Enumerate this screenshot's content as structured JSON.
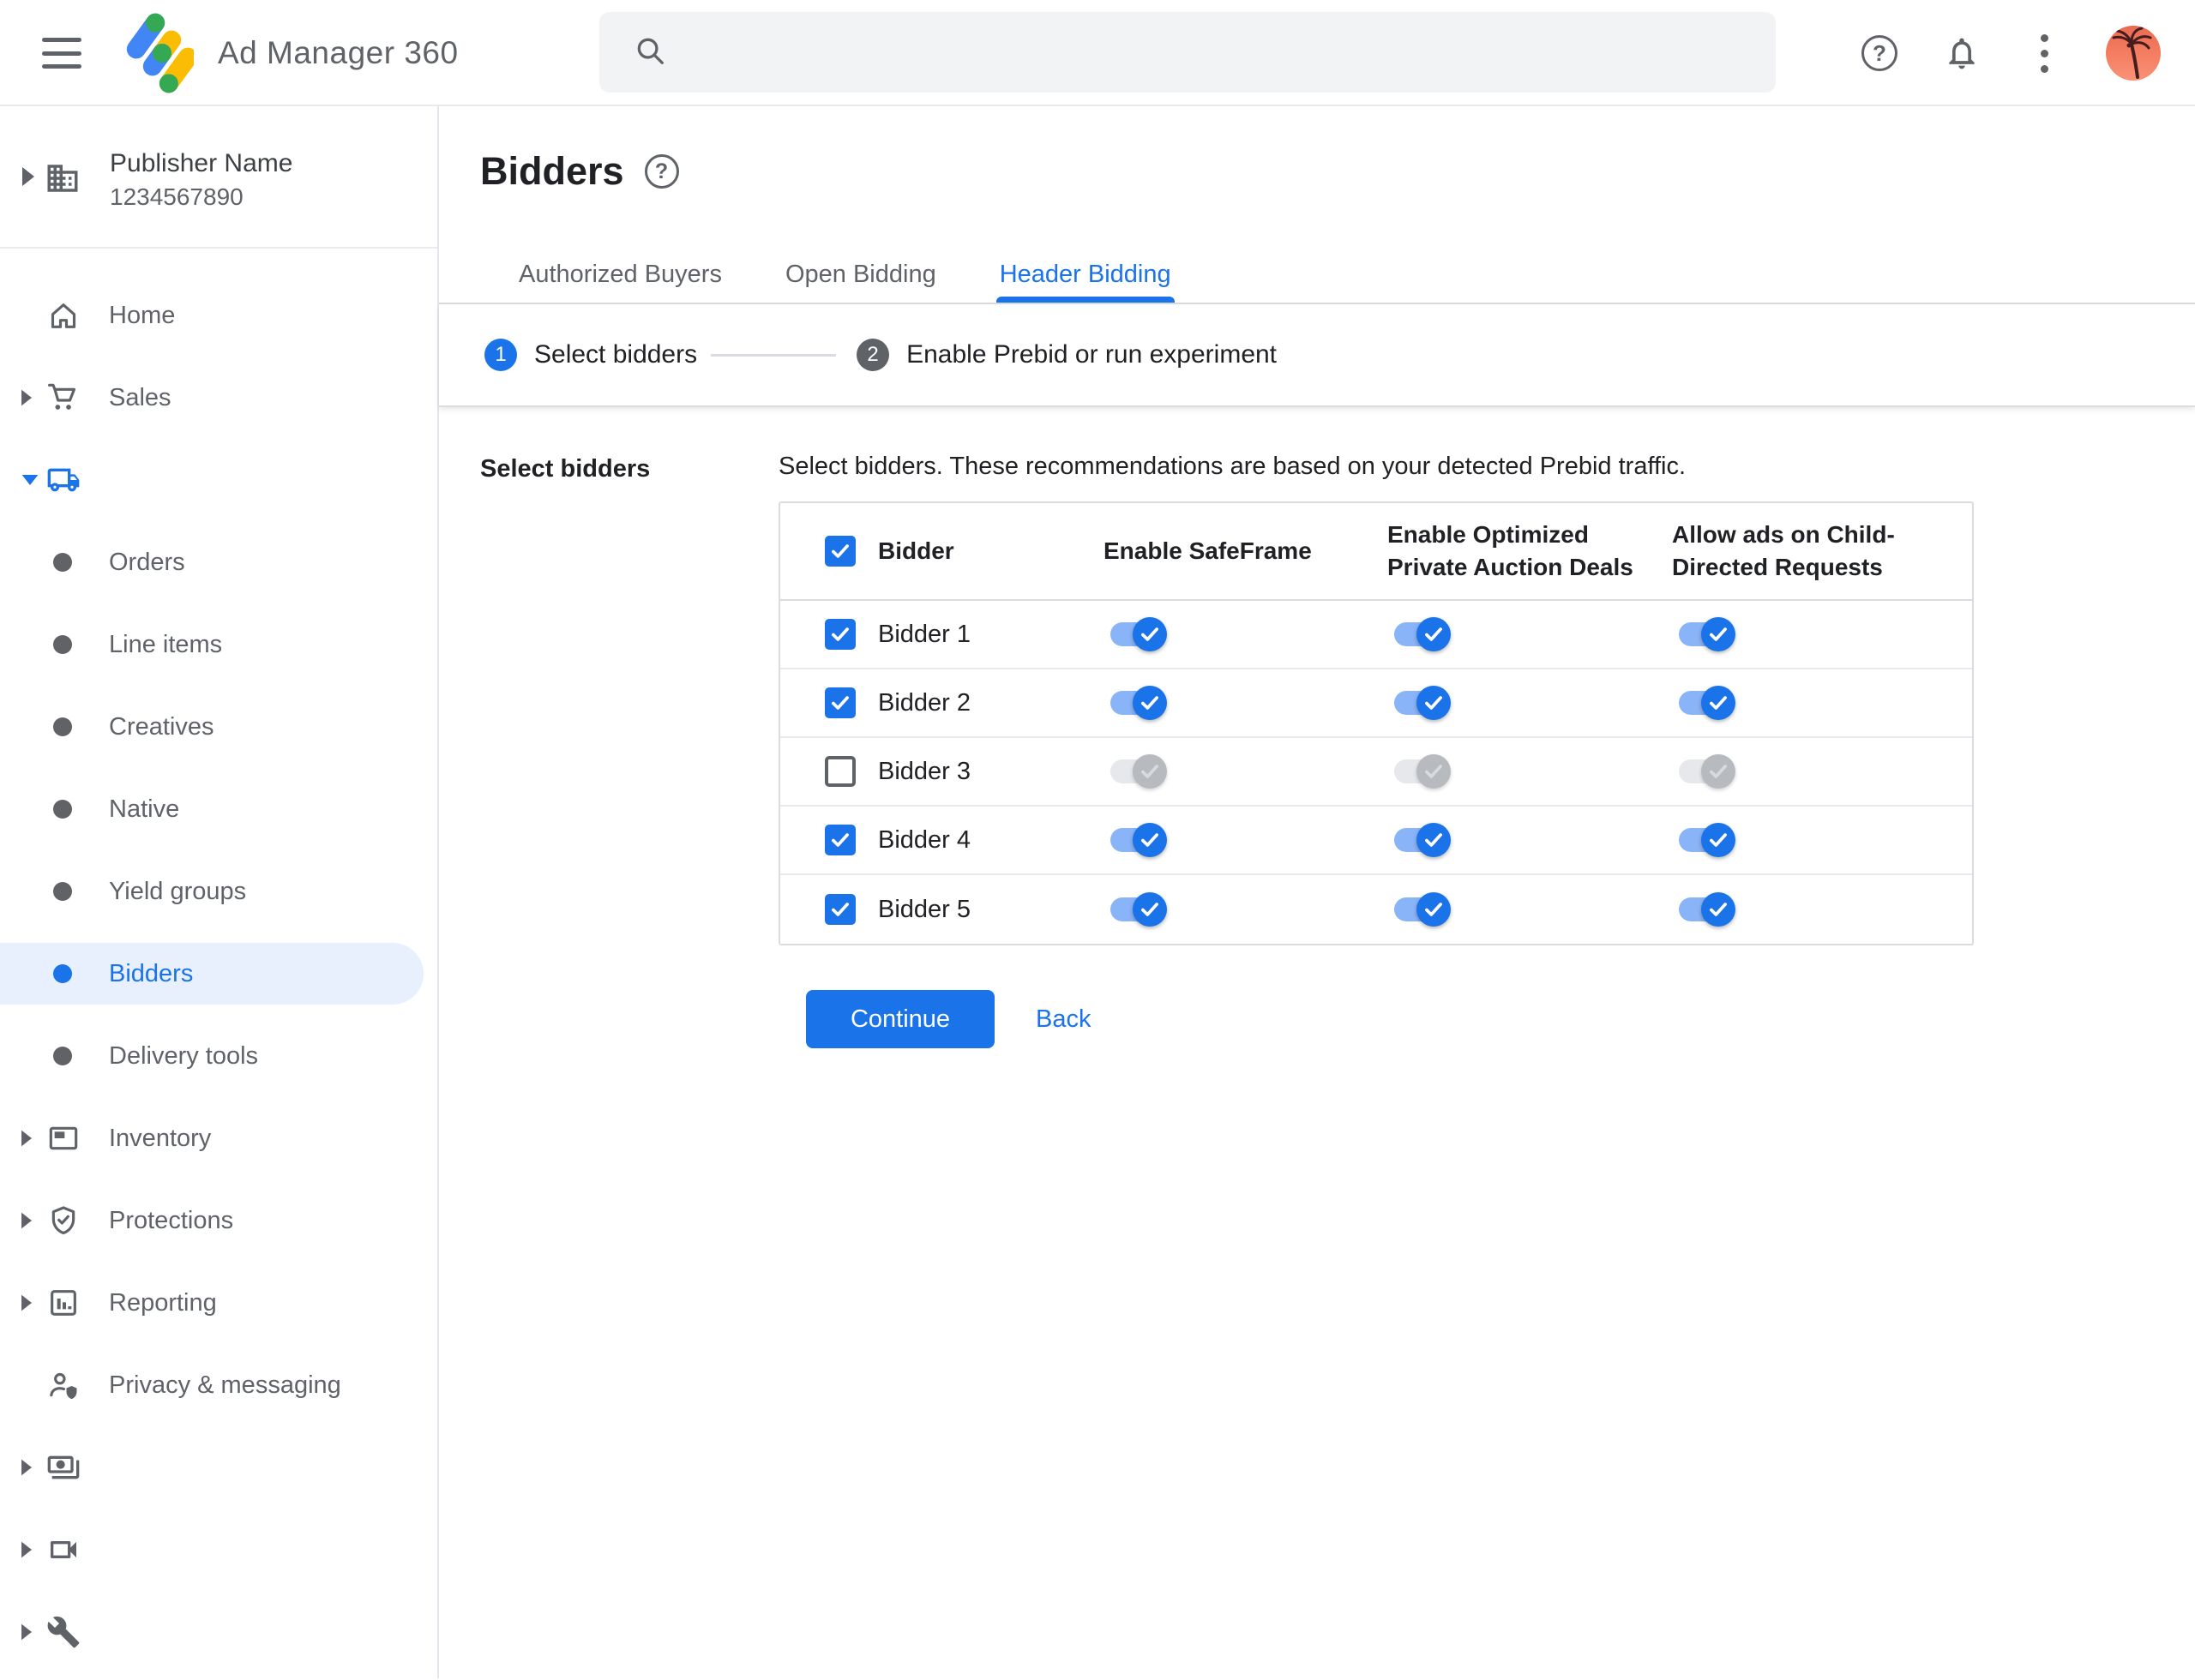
{
  "topbar": {
    "app_title": "Ad Manager 360",
    "search": {
      "placeholder": "",
      "value": ""
    },
    "icons": [
      "menu-icon",
      "ad-manager-logo",
      "search-icon",
      "help-icon",
      "notifications-bell-icon",
      "more-vertical-icon",
      "avatar"
    ]
  },
  "sidebar": {
    "publisher": {
      "name": "Publisher Name",
      "id": "1234567890",
      "icon": "building-icon"
    },
    "items": [
      {
        "label": "Home",
        "icon": "home",
        "type": "top"
      },
      {
        "label": "Sales",
        "icon": "cart",
        "type": "top",
        "caret": "right"
      },
      {
        "label": "Delivery",
        "icon": "truck",
        "type": "top",
        "caret": "down",
        "active": true
      },
      {
        "label": "Orders",
        "type": "sub"
      },
      {
        "label": "Line items",
        "type": "sub"
      },
      {
        "label": "Creatives",
        "type": "sub"
      },
      {
        "label": "Native",
        "type": "sub"
      },
      {
        "label": "Yield groups",
        "type": "sub"
      },
      {
        "label": "Bidders",
        "type": "sub",
        "selected": true
      },
      {
        "label": "Delivery tools",
        "type": "sub"
      },
      {
        "label": "Inventory",
        "icon": "inventory",
        "type": "top",
        "caret": "right"
      },
      {
        "label": "Protections",
        "icon": "shield",
        "type": "top",
        "caret": "right"
      },
      {
        "label": "Reporting",
        "icon": "chart",
        "type": "top",
        "caret": "right"
      },
      {
        "label": "Privacy & messaging",
        "icon": "privacy",
        "type": "top"
      },
      {
        "label": "Billing",
        "icon": "billing",
        "type": "top",
        "caret": "right"
      },
      {
        "label": "Video",
        "icon": "video",
        "type": "top",
        "caret": "right"
      },
      {
        "label": "Admin",
        "icon": "admin",
        "type": "top",
        "caret": "right"
      }
    ]
  },
  "main": {
    "page_title": "Bidders",
    "title_help_icon": "help-icon",
    "tabs": [
      {
        "label": "Authorized Buyers",
        "active": false
      },
      {
        "label": "Open Bidding",
        "active": false
      },
      {
        "label": "Header Bidding",
        "active": true
      }
    ],
    "stepper": [
      {
        "number": "1",
        "label": "Select bidders",
        "state": "active"
      },
      {
        "number": "2",
        "label": "Enable Prebid or run experiment",
        "state": "inactive"
      }
    ],
    "section_label": "Select bidders",
    "description": "Select bidders. These recommendations are based on your detected Prebid traffic.",
    "table": {
      "header_checkbox_checked": true,
      "columns": [
        "Bidder",
        "Enable SafeFrame",
        "Enable Optimized Private Auction Deals",
        "Allow ads on Child-Directed Requests"
      ],
      "rows": [
        {
          "label": "Bidder 1",
          "checked": true,
          "enabled": true,
          "enable_safeframe": true,
          "enable_optimized_private_auction_deals": true,
          "allow_ads_on_child_directed_requests": true
        },
        {
          "label": "Bidder 2",
          "checked": true,
          "enabled": true,
          "enable_safeframe": true,
          "enable_optimized_private_auction_deals": true,
          "allow_ads_on_child_directed_requests": true
        },
        {
          "label": "Bidder 3",
          "checked": false,
          "enabled": false,
          "enable_safeframe": true,
          "enable_optimized_private_auction_deals": true,
          "allow_ads_on_child_directed_requests": true
        },
        {
          "label": "Bidder 4",
          "checked": true,
          "enabled": true,
          "enable_safeframe": true,
          "enable_optimized_private_auction_deals": true,
          "allow_ads_on_child_directed_requests": true
        },
        {
          "label": "Bidder 5",
          "checked": true,
          "enabled": true,
          "enable_safeframe": true,
          "enable_optimized_private_auction_deals": true,
          "allow_ads_on_child_directed_requests": true
        }
      ]
    },
    "actions": {
      "continue_label": "Continue",
      "back_label": "Back"
    }
  },
  "colors": {
    "accent_blue": "#1a73e8",
    "toggle_track_on": "#8ab4f8",
    "selected_pill": "#e8f0fe",
    "gray_text": "#5f6368",
    "dark_text": "#202124",
    "border": "#dadce0",
    "search_bg": "#f1f3f4",
    "logo_blue": "#4285f4",
    "logo_yellow": "#fbbc04",
    "logo_green": "#34a853"
  }
}
